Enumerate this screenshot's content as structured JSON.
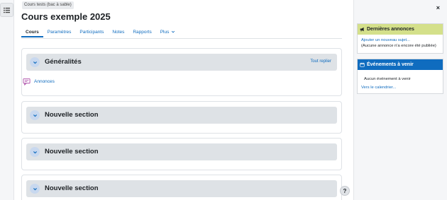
{
  "breadcrumb": {
    "label": "Cours tests (bac à sable)"
  },
  "course": {
    "title": "Cours exemple 2025"
  },
  "tabs": [
    {
      "label": "Cours"
    },
    {
      "label": "Paramètres"
    },
    {
      "label": "Participants"
    },
    {
      "label": "Notes"
    },
    {
      "label": "Rapports"
    },
    {
      "label": "Plus"
    }
  ],
  "sections": [
    {
      "title": "Généralités",
      "collapse_label": "Tout replier",
      "activity": "Annonces"
    },
    {
      "title": "Nouvelle section"
    },
    {
      "title": "Nouvelle section"
    },
    {
      "title": "Nouvelle section"
    }
  ],
  "help": {
    "label": "?"
  },
  "drawer": {
    "close_label": "×"
  },
  "blocks": {
    "announcements": {
      "title": "Dernières annonces",
      "add_link": "Ajouter un nouveau sujet...",
      "empty_text": "(Aucune annonce n'a encore été publiée)"
    },
    "events": {
      "title": "Événements à venir",
      "empty_text": "Aucun événement à venir",
      "calendar_link": "Vers le calendrier..."
    }
  },
  "colors": {
    "link": "#0f6cbf",
    "section_header": "#dee2e6",
    "announce_header": "#d4e08a",
    "events_header": "#0f6cbf"
  }
}
